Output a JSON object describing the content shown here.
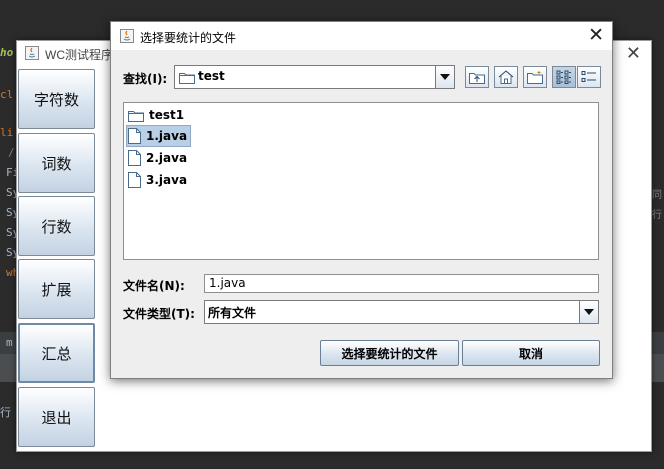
{
  "ide": {
    "lines": [
      "cl",
      "li",
      "/",
      "Fi",
      "Sy",
      "Sy",
      "Sy",
      "Sy",
      "wh"
    ],
    "top_snippet": "ho",
    "right_snippets": [
      "同",
      "行"
    ],
    "bottom_snippets": [
      "m",
      "行"
    ]
  },
  "app": {
    "title": "WC测试程序",
    "sidebar": [
      {
        "label": "字符数"
      },
      {
        "label": "词数"
      },
      {
        "label": "行数"
      },
      {
        "label": "扩展"
      },
      {
        "label": "汇总"
      },
      {
        "label": "退出"
      }
    ]
  },
  "dialog": {
    "title": "选择要统计的文件",
    "lookin_label": "查找(I):",
    "lookin_value": "test",
    "toolbar_icons": [
      "up-folder-icon",
      "home-icon",
      "new-folder-icon",
      "list-view-icon",
      "details-view-icon"
    ],
    "files": [
      {
        "name": "test1",
        "type": "folder",
        "selected": false
      },
      {
        "name": "1.java",
        "type": "file",
        "selected": true
      },
      {
        "name": "2.java",
        "type": "file",
        "selected": false
      },
      {
        "name": "3.java",
        "type": "file",
        "selected": false
      }
    ],
    "filename_label": "文件名(N):",
    "filename_value": "1.java",
    "filetype_label": "文件类型(T):",
    "filetype_value": "所有文件",
    "approve_button": "选择要统计的文件",
    "cancel_button": "取消"
  }
}
